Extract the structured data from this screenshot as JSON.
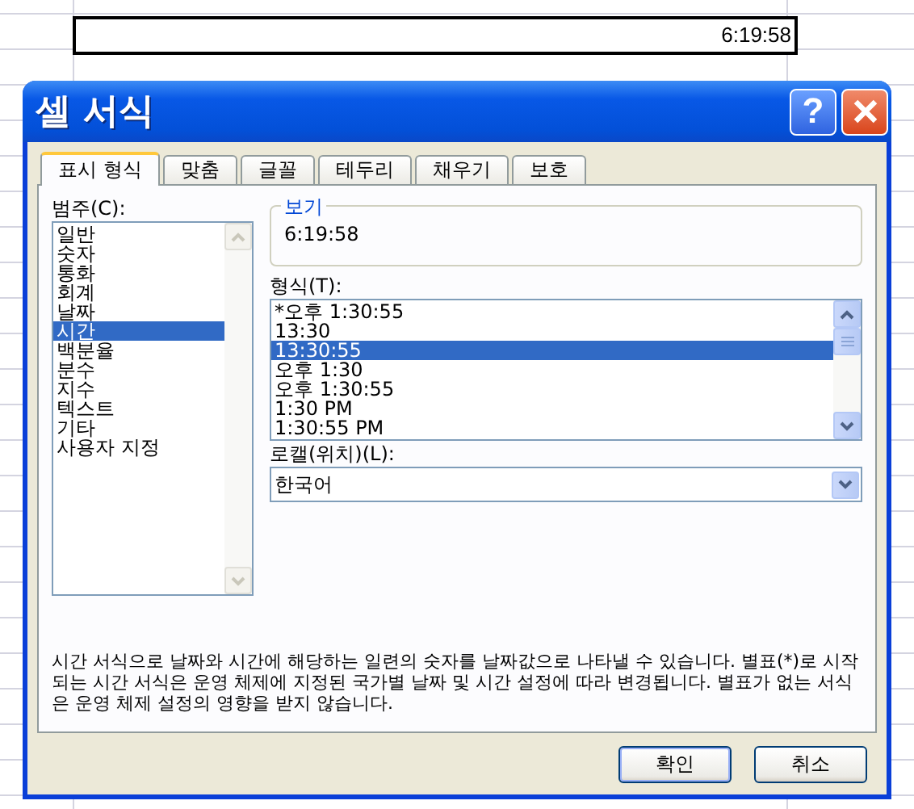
{
  "sheet": {
    "cell_value": "6:19:58"
  },
  "dialog": {
    "title": "셀 서식",
    "help_button": "?",
    "tabs": [
      {
        "label": "표시 형식",
        "selected": true
      },
      {
        "label": "맞춤",
        "selected": false
      },
      {
        "label": "글꼴",
        "selected": false
      },
      {
        "label": "테두리",
        "selected": false
      },
      {
        "label": "채우기",
        "selected": false
      },
      {
        "label": "보호",
        "selected": false
      }
    ],
    "category": {
      "label": "범주(C):",
      "items": [
        {
          "label": "일반",
          "selected": false
        },
        {
          "label": "숫자",
          "selected": false
        },
        {
          "label": "통화",
          "selected": false
        },
        {
          "label": "회계",
          "selected": false
        },
        {
          "label": "날짜",
          "selected": false
        },
        {
          "label": "시간",
          "selected": true
        },
        {
          "label": "백분율",
          "selected": false
        },
        {
          "label": "분수",
          "selected": false
        },
        {
          "label": "지수",
          "selected": false
        },
        {
          "label": "텍스트",
          "selected": false
        },
        {
          "label": "기타",
          "selected": false
        },
        {
          "label": "사용자 지정",
          "selected": false
        }
      ]
    },
    "preview": {
      "label": "보기",
      "value": "6:19:58"
    },
    "format": {
      "label": "형식(T):",
      "items": [
        {
          "label": "*오후 1:30:55",
          "selected": false
        },
        {
          "label": "13:30",
          "selected": false
        },
        {
          "label": "13:30:55",
          "selected": true
        },
        {
          "label": "오후 1:30",
          "selected": false
        },
        {
          "label": "오후 1:30:55",
          "selected": false
        },
        {
          "label": "1:30 PM",
          "selected": false
        },
        {
          "label": "1:30:55 PM",
          "selected": false
        }
      ]
    },
    "locale": {
      "label": "로캘(위치)(L):",
      "value": "한국어"
    },
    "description": "시간 서식으로 날짜와 시간에 해당하는 일련의 숫자를 날짜값으로 나타낼 수 있습니다. 별표(*)로 시작되는 시간 서식은 운영 체제에 지정된 국가별 날짜 및 시간 설정에 따라 변경됩니다. 별표가 없는 서식은 운영 체제 설정의 영향을 받지 않습니다.",
    "buttons": [
      "확인",
      "취소"
    ]
  }
}
